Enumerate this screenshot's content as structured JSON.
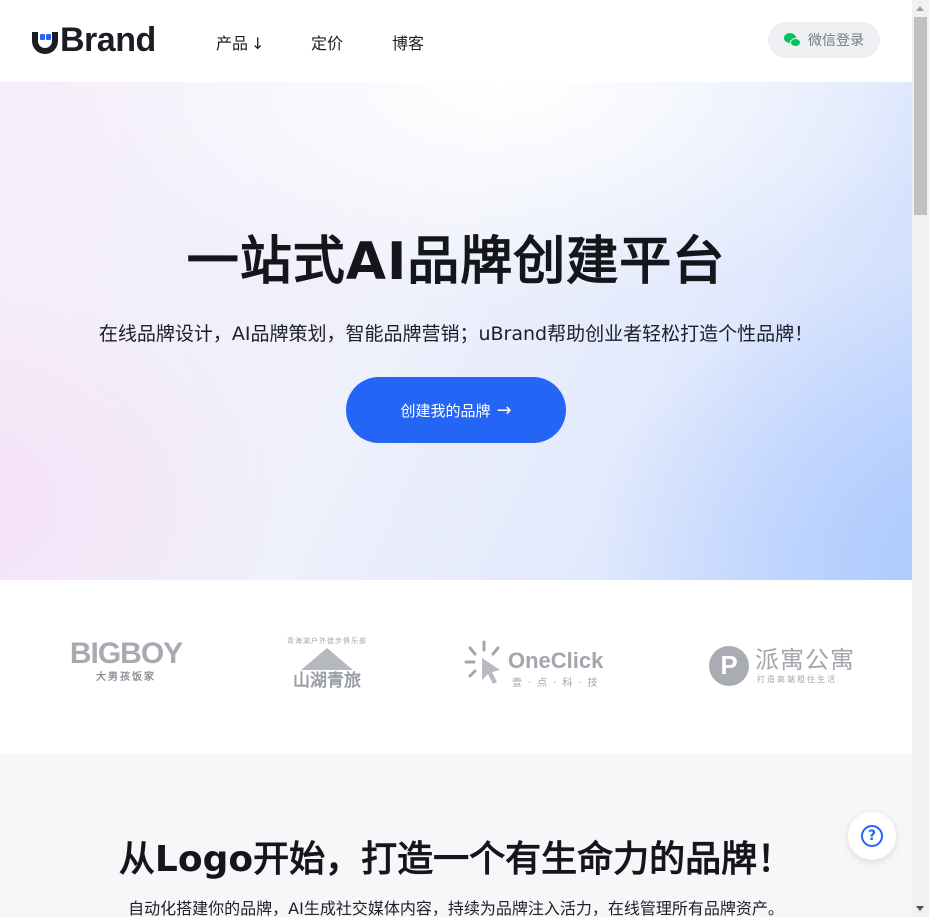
{
  "header": {
    "logo_text": "Brand",
    "nav": [
      {
        "label": "产品",
        "arrow": "↓"
      },
      {
        "label": "定价"
      },
      {
        "label": "博客"
      }
    ],
    "wechat_login_label": "微信登录"
  },
  "hero": {
    "title": "一站式AI品牌创建平台",
    "subtitle": "在线品牌设计，AI品牌策划，智能品牌营销；uBrand帮助创业者轻松打造个性品牌！",
    "cta_label": "创建我的品牌",
    "cta_arrow": "→"
  },
  "partners": {
    "bigboy": {
      "name": "BIGBOY",
      "tagline": "大男孩饭家"
    },
    "shanhu": {
      "arc_text": "青海湖户外徒步俱乐部",
      "name": "山湖青旅"
    },
    "oneclick": {
      "name": "OneClick",
      "tagline": "壹·点·科·技"
    },
    "paiyu": {
      "mark": "P",
      "name": "派寓公寓",
      "tagline": "打造高端租住生活"
    }
  },
  "section2": {
    "title": "从Logo开始，打造一个有生命力的品牌！",
    "subtitle": "自动化搭建你的品牌，AI生成社交媒体内容，持续为品牌注入活力，在线管理所有品牌资产。"
  },
  "help": {
    "icon": "?"
  },
  "colors": {
    "accent": "#2565f5",
    "wechat": "#07c160",
    "text": "#14161c"
  }
}
